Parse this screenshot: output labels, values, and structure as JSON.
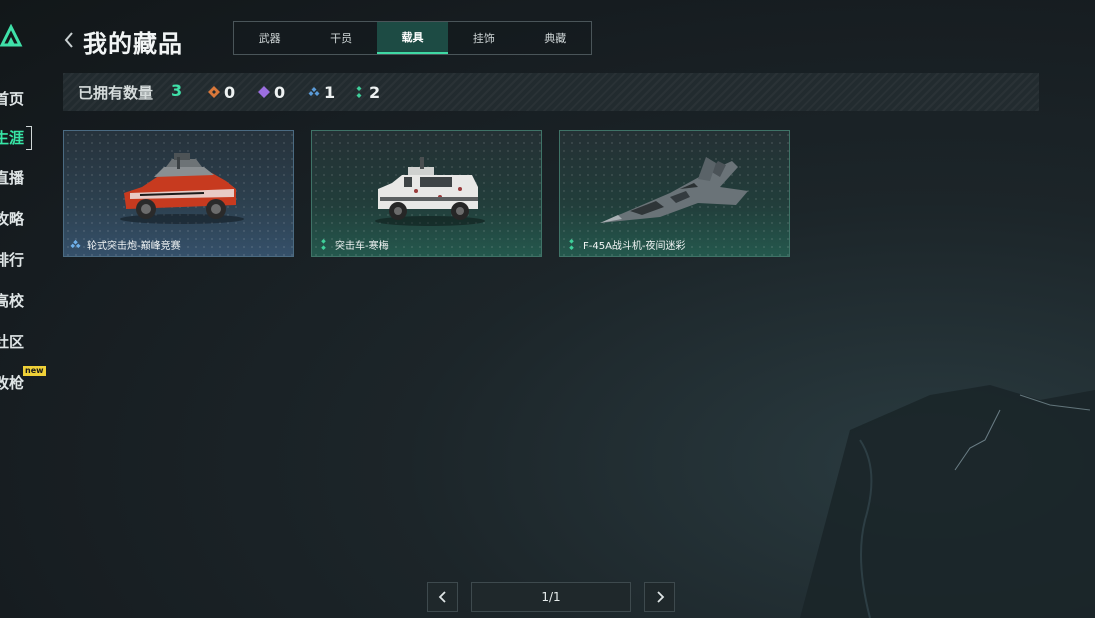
{
  "header": {
    "title": "我的藏品",
    "back_icon": "chevron-left-icon"
  },
  "sidebar": {
    "logo_icon": "triangle-logo-icon",
    "items": [
      {
        "label": "首页"
      },
      {
        "label": "生涯",
        "active": true
      },
      {
        "label": "直播"
      },
      {
        "label": "攻略"
      },
      {
        "label": "排行"
      },
      {
        "label": "高校"
      },
      {
        "label": "社区"
      },
      {
        "label": "改枪",
        "badge": "new"
      }
    ]
  },
  "tabs": [
    {
      "label": "武器"
    },
    {
      "label": "干员"
    },
    {
      "label": "载具",
      "active": true
    },
    {
      "label": "挂饰"
    },
    {
      "label": "典藏"
    }
  ],
  "summary": {
    "owned_label": "已拥有数量",
    "owned_total": "3",
    "rarities": [
      {
        "icon": "orange-diamond-icon",
        "color": "#d9783a",
        "count": "0"
      },
      {
        "icon": "purple-diamond-icon",
        "color": "#9b6ee0",
        "count": "0"
      },
      {
        "icon": "blue-triple-diamond-icon",
        "color": "#5b9bd8",
        "count": "1"
      },
      {
        "icon": "green-double-diamond-icon",
        "color": "#3fcf9a",
        "count": "2"
      }
    ]
  },
  "cards": [
    {
      "name": "轮式突击炮-巅峰竞赛",
      "rarity_icon": "blue-triple-diamond-icon",
      "image": "red-armored-car-image"
    },
    {
      "name": "突击车-寒梅",
      "rarity_icon": "green-double-diamond-icon",
      "image": "white-assault-vehicle-image"
    },
    {
      "name": "F-45A战斗机-夜间迷彩",
      "rarity_icon": "green-double-diamond-icon",
      "image": "camo-fighter-jet-image"
    }
  ],
  "pager": {
    "current": "1/1",
    "prev_icon": "chevron-left-icon",
    "next_icon": "chevron-right-icon"
  },
  "colors": {
    "accent": "#3fe0a8",
    "badge": "#f0d138"
  }
}
